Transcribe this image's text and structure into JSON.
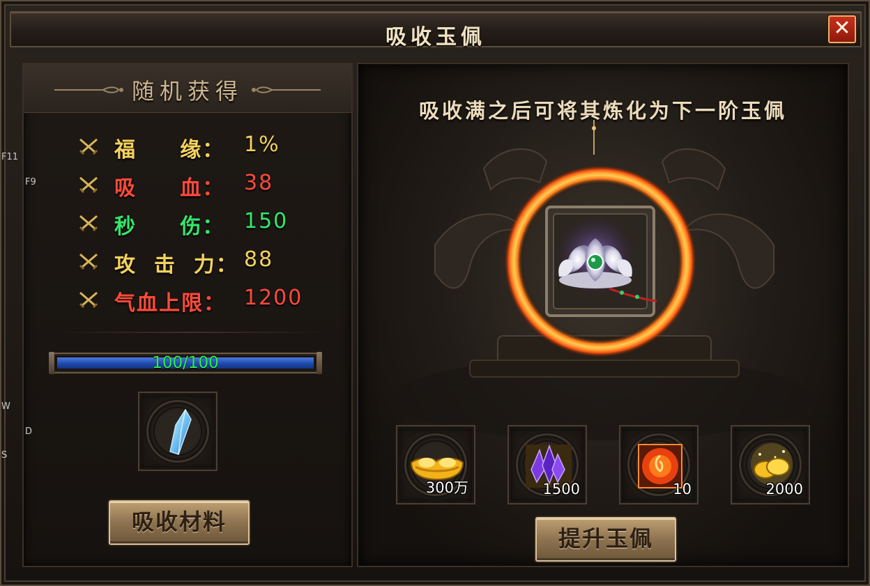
{
  "window": {
    "title": "吸收玉佩",
    "close_label": "✕"
  },
  "left": {
    "header": "随机获得",
    "stats": [
      {
        "label": "福     缘：",
        "value": "1%",
        "color": "#f4d25e"
      },
      {
        "label": "吸     血：",
        "value": "38",
        "color": "#ff4a3a"
      },
      {
        "label": "秒     伤：",
        "value": "150",
        "color": "#33e86a"
      },
      {
        "label": "攻  击  力：",
        "value": "88",
        "color": "#f4d25e"
      },
      {
        "label": "气血上限：",
        "value": "1200",
        "color": "#ff4a3a"
      }
    ],
    "progress": {
      "text": "100/100",
      "fraction": 1.0
    },
    "material_icon": "blue-crystal-icon",
    "absorb_button": "吸收材料"
  },
  "right": {
    "hint": "吸收满之后可将其炼化为下一阶玉佩",
    "artifact_icon": "jade-lotus-pendant-icon",
    "costs": [
      {
        "icon": "gold-ingot-icon",
        "qty": "300万"
      },
      {
        "icon": "purple-crystal-icon",
        "qty": "1500"
      },
      {
        "icon": "fire-orb-icon",
        "qty": "10"
      },
      {
        "icon": "gold-coins-icon",
        "qty": "2000"
      }
    ],
    "upgrade_button": "提升玉佩"
  },
  "edge_labels": [
    "F11",
    "F9",
    "W",
    "D",
    "S"
  ]
}
